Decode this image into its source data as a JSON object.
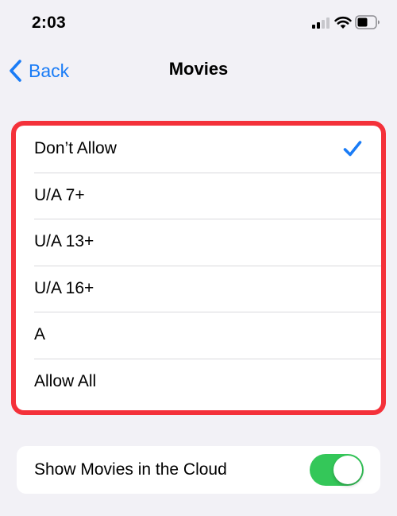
{
  "status_bar": {
    "time": "2:03",
    "icons": [
      "signal-icon",
      "wifi-icon",
      "battery-icon"
    ]
  },
  "nav": {
    "back_label": "Back",
    "title": "Movies"
  },
  "options": [
    {
      "label": "Don’t Allow",
      "selected": true
    },
    {
      "label": "U/A 7+",
      "selected": false
    },
    {
      "label": "U/A 13+",
      "selected": false
    },
    {
      "label": "U/A 16+",
      "selected": false
    },
    {
      "label": "A",
      "selected": false
    },
    {
      "label": "Allow All",
      "selected": false
    }
  ],
  "cloud": {
    "label": "Show Movies in the Cloud",
    "enabled": true
  },
  "colors": {
    "accent": "#1a7cf6",
    "highlight": "#f4313a",
    "toggle_on": "#34c759",
    "background": "#f2f1f6"
  }
}
